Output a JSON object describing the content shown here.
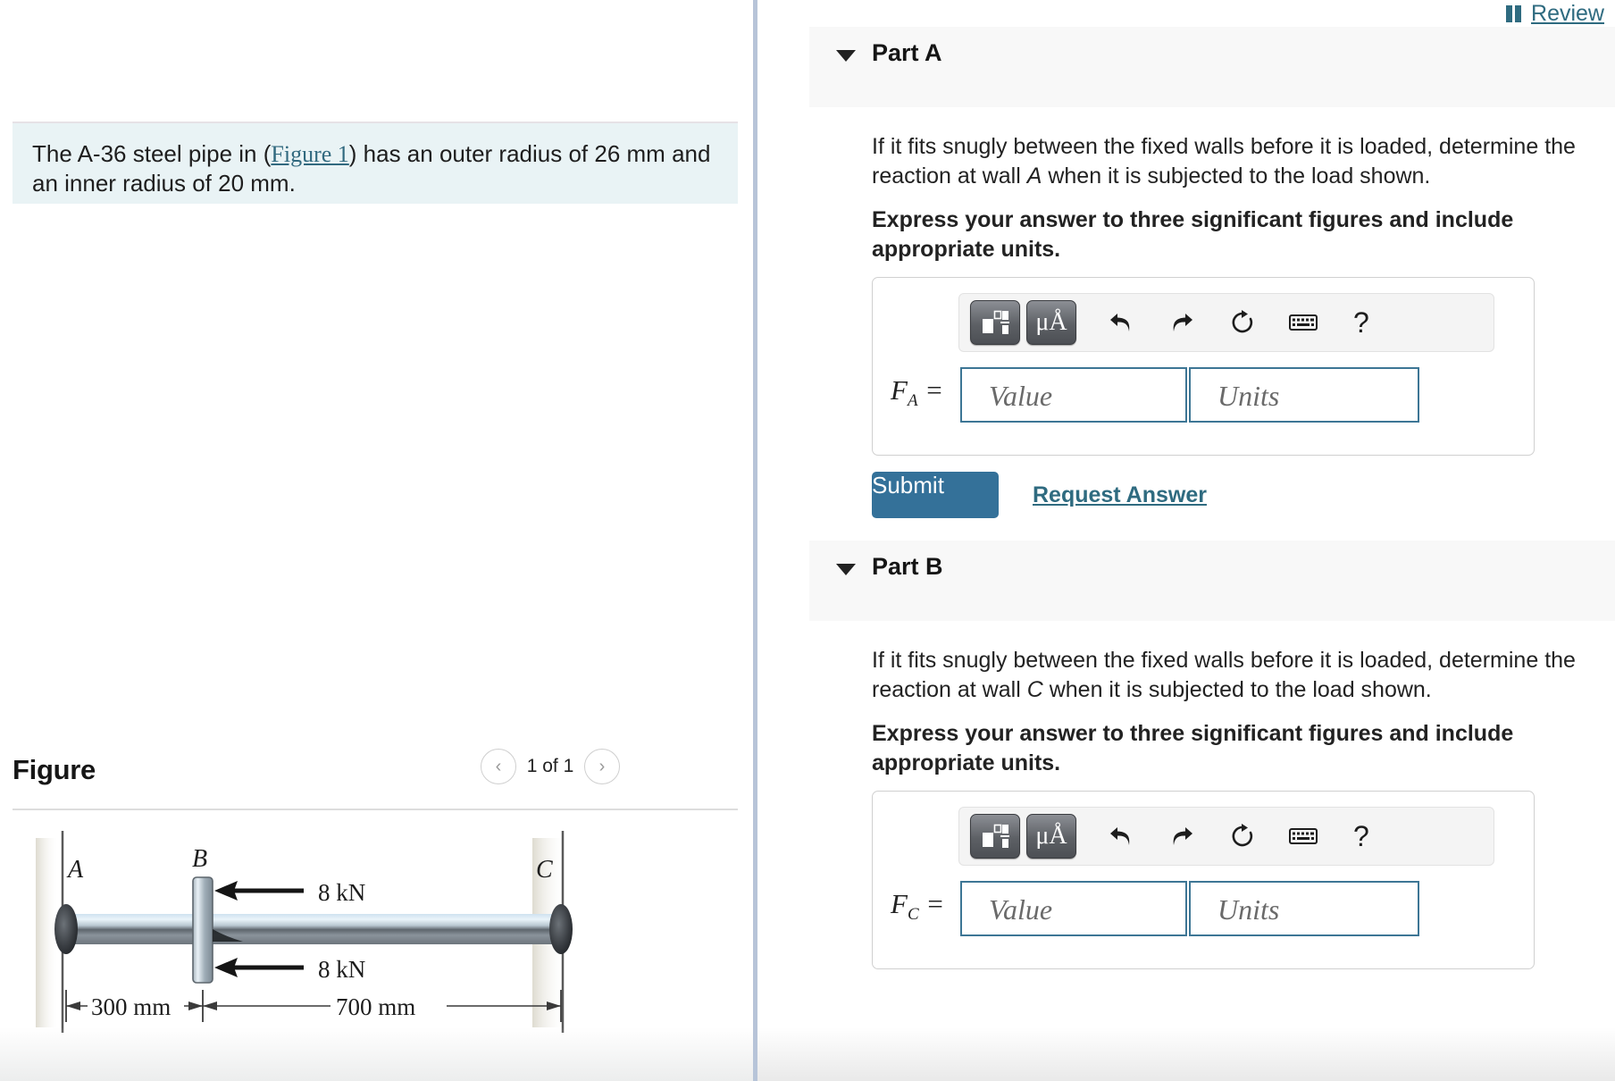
{
  "left": {
    "question": {
      "prefix": "The A-36 steel pipe in (",
      "figure_link": "Figure 1",
      "suffix": ") has an outer radius of 26 mm and an inner radius of 20 mm."
    },
    "figure": {
      "title": "Figure",
      "pager_label": "1 of 1",
      "prev_icon": "chevron-left-icon",
      "next_icon": "chevron-right-icon",
      "diagram": {
        "label_a": "A",
        "label_b": "B",
        "label_c": "C",
        "force_top": "8 kN",
        "force_bottom": "8 kN",
        "dim_left": "300 mm",
        "dim_right": "700 mm"
      }
    }
  },
  "right": {
    "review": {
      "label": "Review",
      "icon": "book-icon"
    },
    "parts": [
      {
        "title": "Part A",
        "caret_icon": "caret-down-icon",
        "prompt_line1": "If it fits snugly between the fixed walls before it is loaded, determine",
        "prompt_line2_pre": "the reaction at wall ",
        "prompt_line2_var": "A",
        "prompt_line2_post": " when it is subjected to the load shown.",
        "express": "Express your answer to three significant figures and include appropriate units.",
        "toolbar": {
          "template_icon": "math-template-icon",
          "units_label": "μÅ",
          "undo_icon": "undo-icon",
          "redo_icon": "redo-icon",
          "reset_icon": "reset-icon",
          "keyboard_icon": "keyboard-icon",
          "help_label": "?"
        },
        "var_name": "F",
        "var_sub": "A",
        "equals": " =",
        "value_placeholder": "Value",
        "units_placeholder": "Units",
        "value_current": "",
        "units_current": "",
        "submit_label": "Submit",
        "request_label": "Request Answer"
      },
      {
        "title": "Part B",
        "caret_icon": "caret-down-icon",
        "prompt_line1": "If it fits snugly between the fixed walls before it is loaded, determine",
        "prompt_line2_pre": "the reaction at wall ",
        "prompt_line2_var": "C",
        "prompt_line2_post": " when it is subjected to the load shown.",
        "express": "Express your answer to three significant figures and include appropriate units.",
        "toolbar": {
          "template_icon": "math-template-icon",
          "units_label": "μÅ",
          "undo_icon": "undo-icon",
          "redo_icon": "redo-icon",
          "reset_icon": "reset-icon",
          "keyboard_icon": "keyboard-icon",
          "help_label": "?"
        },
        "var_name": "F",
        "var_sub": "C",
        "equals": " =",
        "value_placeholder": "Value",
        "units_placeholder": "Units",
        "value_current": "",
        "units_current": ""
      }
    ]
  },
  "colors": {
    "accent": "#2f6b80",
    "submit": "#347199",
    "question_bg": "#e9f3f5",
    "field_border": "#3d7695",
    "divider": "#b7c4d8"
  }
}
